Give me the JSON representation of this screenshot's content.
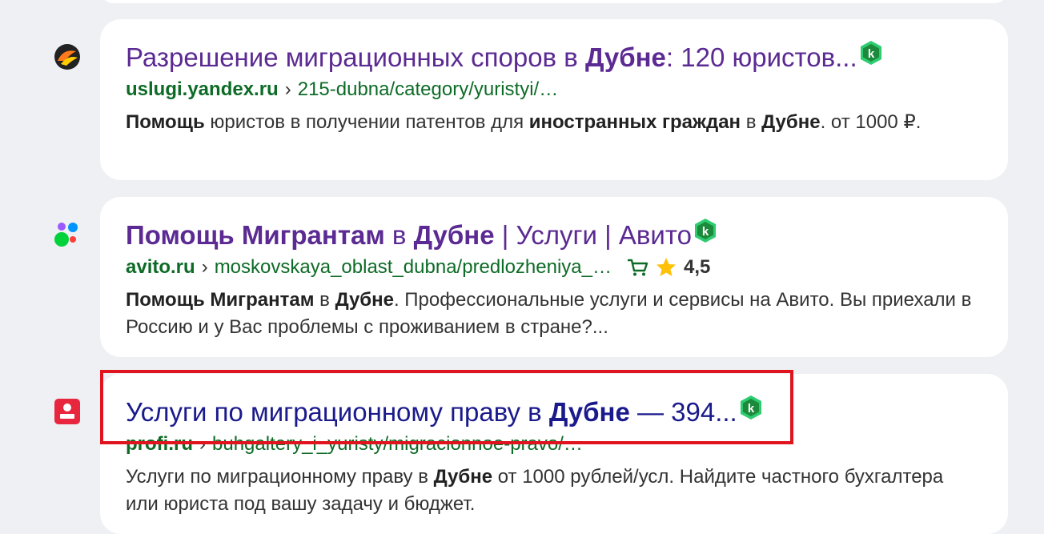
{
  "results": [
    {
      "title_parts": [
        "Разрешение миграционных споров в ",
        "Дубне",
        ": 120 юристов..."
      ],
      "host": "uslugi.yandex.ru",
      "path": "215-dubna/category/yuristyi/…",
      "snippet_parts": [
        "Помощь",
        " юристов в получении патентов для ",
        "иностранных граждан",
        " в ",
        "Дубне",
        ". от 1000 ₽."
      ]
    },
    {
      "title_parts": [
        "Помощь Мигрантам",
        " в ",
        "Дубне",
        " | Услуги | Авито"
      ],
      "host": "avito.ru",
      "path": "moskovskaya_oblast_dubna/predlozheniya_…",
      "rating": "4,5",
      "snippet_parts": [
        "Помощь Мигрантам",
        " в ",
        "Дубне",
        ". Профессиональные услуги и сервисы на Авито. Вы приехали в Россию и у Вас проблемы с проживанием в стране?..."
      ]
    },
    {
      "title_parts": [
        "Услуги по миграционному праву в ",
        "Дубне",
        " — 394..."
      ],
      "host": "profi.ru",
      "path": "buhgaltery_i_yuristy/migracionnoe-pravo/…",
      "snippet_parts": [
        "Услуги по миграционному праву в ",
        "Дубне",
        " от 1000 рублей/усл. Найдите частного бухгалтера или юриста под вашу задачу и бюджет."
      ]
    }
  ],
  "url_separator": "›",
  "colors": {
    "title_visited": "#5b2a92",
    "title_unvisited": "#1a1a8c",
    "url_green": "#0d6b26",
    "highlight_red": "#e0141e",
    "badge_green": "#2ecc71"
  },
  "icons": {
    "result1_favicon": "yandex-uslugi-icon",
    "result2_favicon": "avito-icon",
    "result3_favicon": "profi-icon",
    "safety_badge": "kaspersky-badge-icon",
    "cart": "cart-icon",
    "star": "star-icon"
  }
}
